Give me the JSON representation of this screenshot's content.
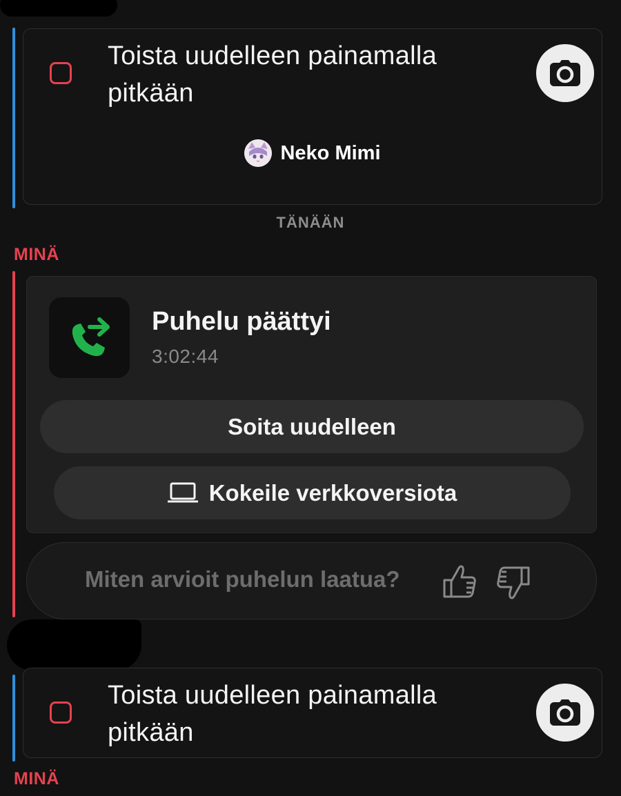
{
  "snap_top": {
    "text": "Toista uudelleen painamalla pitkään",
    "author_name": "Neko Mimi",
    "camera_icon": "camera-icon"
  },
  "day_separator": "TÄNÄÄN",
  "sender_1": "MINÄ",
  "call": {
    "title": "Puhelu päättyi",
    "duration": "3:02:44",
    "call_again_label": "Soita uudelleen",
    "web_version_label": "Kokeile verkkoversiota",
    "icon": "outgoing-call-icon"
  },
  "rating": {
    "question": "Miten arvioit puhelun laatua?",
    "up_icon": "thumbs-up-icon",
    "down_icon": "thumbs-down-icon"
  },
  "snap_bottom": {
    "text": "Toista uudelleen painamalla pitkään",
    "camera_icon": "camera-icon"
  },
  "sender_2": "MINÄ",
  "colors": {
    "accent_red": "#e5424f",
    "accent_blue": "#2f8fdb",
    "call_green": "#22b24c",
    "background": "#121212"
  }
}
